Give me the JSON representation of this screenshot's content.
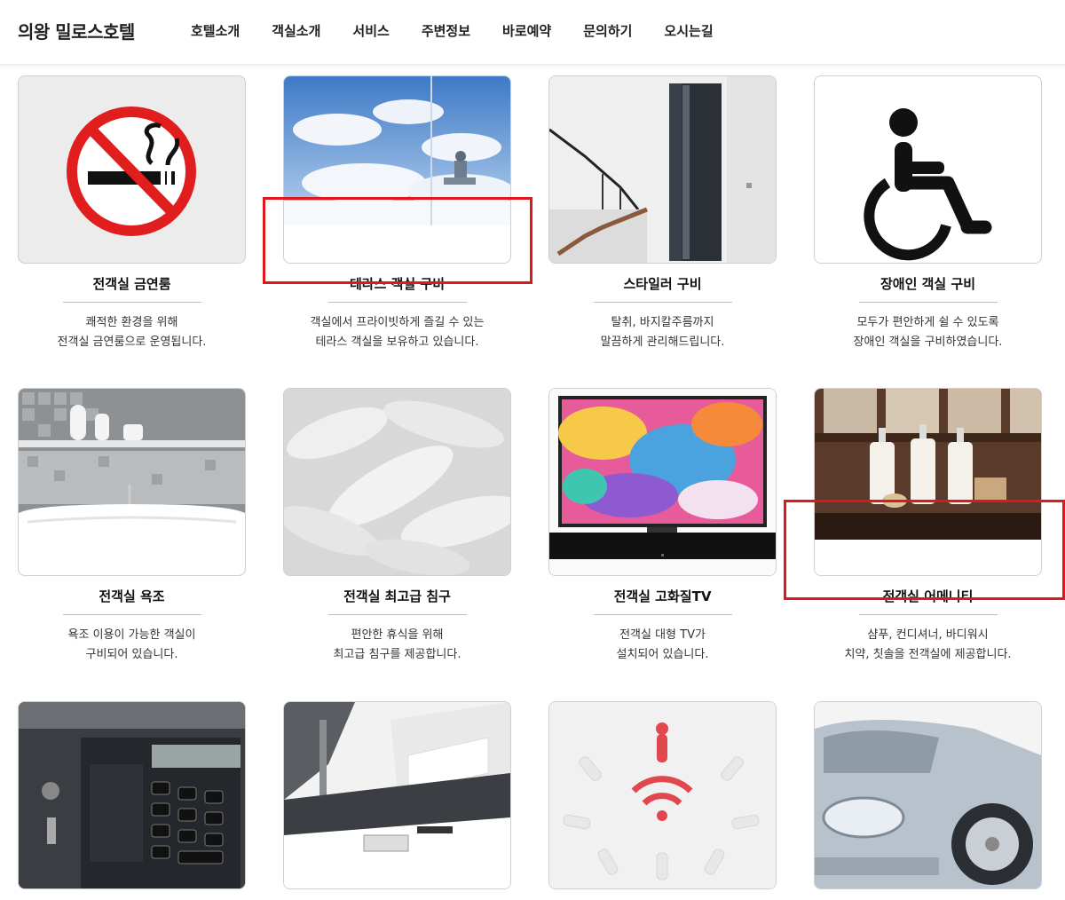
{
  "header": {
    "logo": "의왕 밀로스호텔",
    "nav": [
      "호텔소개",
      "객실소개",
      "서비스",
      "주변정보",
      "바로예약",
      "문의하기",
      "오시는길"
    ]
  },
  "cards": [
    {
      "title": "전객실 금연룸",
      "desc": "쾌적한 환경을 위해\n전객실 금연룸으로 운영됩니다.",
      "icon": "no-smoking-icon"
    },
    {
      "title": "테라스 객실 구비",
      "desc": "객실에서 프라이빗하게 즐길 수 있는\n테라스 객실을 보유하고 있습니다.",
      "icon": "terrace-clouds-image"
    },
    {
      "title": "스타일러 구비",
      "desc": "탈취, 바지칼주름까지\n말끔하게 관리해드립니다.",
      "icon": "styler-image"
    },
    {
      "title": "장애인 객실 구비",
      "desc": "모두가 편안하게 쉴 수 있도록\n장애인 객실을 구비하였습니다.",
      "icon": "wheelchair-icon"
    },
    {
      "title": "전객실 욕조",
      "desc": "욕조 이용이 가능한 객실이\n구비되어 있습니다.",
      "icon": "bathtub-image"
    },
    {
      "title": "전객실 최고급 침구",
      "desc": "편안한 휴식을 위해\n최고급 침구를 제공합니다.",
      "icon": "feathers-image"
    },
    {
      "title": "전객실 고화질TV",
      "desc": "전객실 대형 TV가\n설치되어 있습니다.",
      "icon": "tv-image"
    },
    {
      "title": "전객실 어메니티",
      "desc": "샴푸, 컨디셔너, 바디워시\n치약, 칫솔을 전객실에 제공합니다.",
      "icon": "amenity-bottles-image"
    },
    {
      "title": "",
      "desc": "",
      "icon": "safe-keypad-image"
    },
    {
      "title": "",
      "desc": "",
      "icon": "lobby-desk-image"
    },
    {
      "title": "",
      "desc": "",
      "icon": "wifi-people-image"
    },
    {
      "title": "",
      "desc": "",
      "icon": "car-parking-image"
    }
  ],
  "colors": {
    "highlight": "#e0171f",
    "no_smoking_red": "#e01e1e"
  }
}
